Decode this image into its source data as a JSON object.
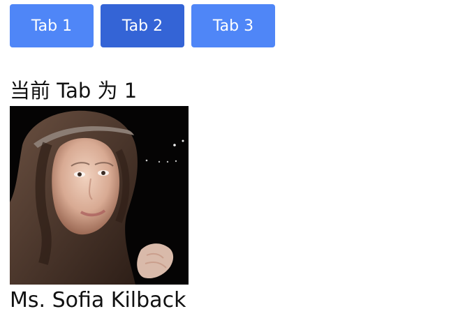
{
  "tabs": [
    {
      "label": "Tab 1"
    },
    {
      "label": "Tab 2",
      "active": true
    },
    {
      "label": "Tab 3"
    }
  ],
  "current_tab_text": "当前 Tab 为 1",
  "profile": {
    "name": "Ms. Sofia Kilback"
  },
  "colors": {
    "tab": "#4f86f7",
    "tab_active": "#3464d6",
    "text": "#111111",
    "background": "#ffffff"
  }
}
